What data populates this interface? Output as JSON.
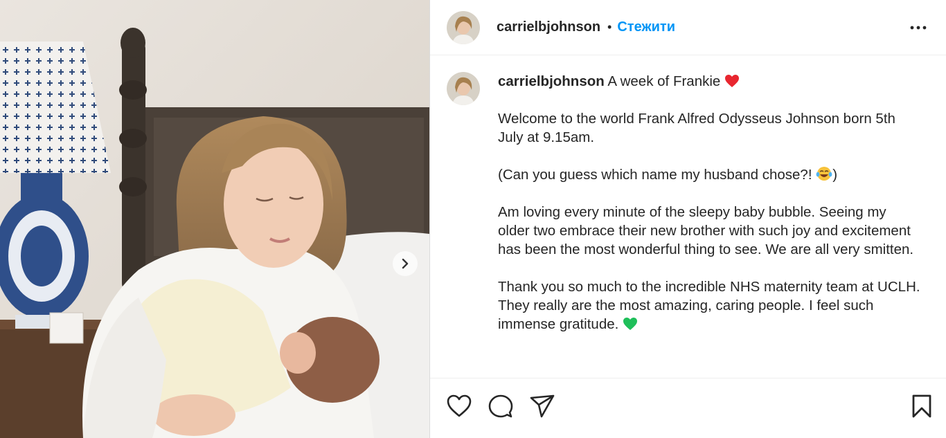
{
  "header": {
    "username": "carrielbjohnson",
    "separator": "•",
    "follow_label": "Стежити"
  },
  "caption": {
    "username": "carrielbjohnson",
    "title": "A week of Frankie",
    "paragraphs": [
      "Welcome to the world Frank Alfred Odysseus Johnson born 5th July at 9.15am.",
      "(Can you guess which name my husband chose?!",
      "Am loving every minute of the sleepy baby bubble. Seeing my older two embrace their new brother with such joy and excitement has been the most wonderful thing to see. We are all very smitten.",
      "Thank you so much to the incredible NHS maternity team at UCLH. They really are the most amazing, caring people. I feel such immense gratitude."
    ],
    "paren_close": ")",
    "emojis": {
      "title": "red-heart",
      "guess": "tears-of-joy",
      "gratitude": "green-heart"
    }
  },
  "icons": {
    "more": "more-horizontal-icon",
    "next": "chevron-right-icon",
    "like": "heart-icon",
    "comment": "comment-icon",
    "share": "share-icon",
    "save": "bookmark-icon"
  },
  "colors": {
    "follow": "#0095f6",
    "text": "#262626",
    "divider": "#efefef"
  }
}
